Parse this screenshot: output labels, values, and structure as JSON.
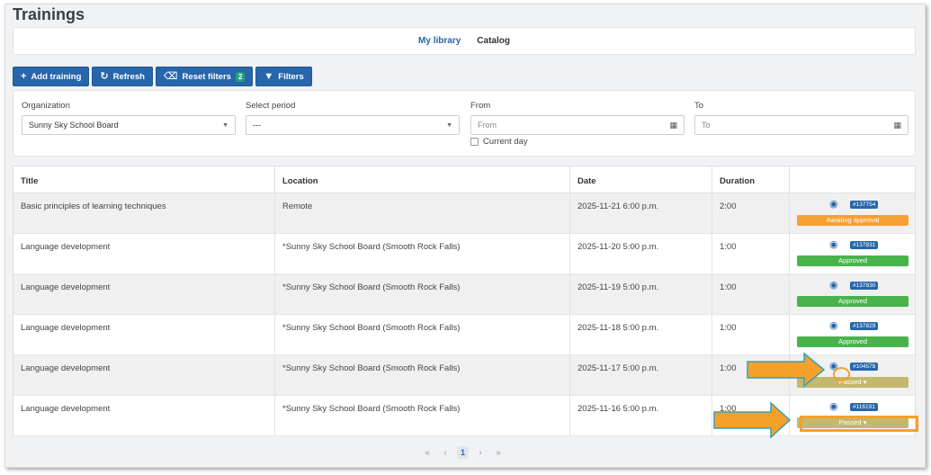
{
  "page": {
    "title": "Trainings"
  },
  "tabs": [
    "My library",
    "Catalog"
  ],
  "toolbar": {
    "add_label": "Add training",
    "refresh_label": "Refresh",
    "reset_label": "Reset filters",
    "reset_count": "2",
    "filters_label": "Filters"
  },
  "filters": {
    "organization_label": "Organization",
    "organization_value": "Sunny Sky School Board",
    "period_label": "Select period",
    "period_value": "---",
    "from_label": "From",
    "from_placeholder": "From",
    "current_day_label": "Current day",
    "to_label": "To",
    "to_placeholder": "To"
  },
  "table": {
    "columns": [
      "Title",
      "Location",
      "Date",
      "Duration",
      ""
    ],
    "rows": [
      {
        "title": "Basic principles of learning techniques",
        "location": "Remote",
        "date": "2025-11-21 6:00 p.m.",
        "duration": "2:00",
        "id": "#137754",
        "status": "Awaiting approval",
        "status_type": "await"
      },
      {
        "title": "Language development",
        "location": "*Sunny Sky School Board (Smooth Rock Falls)",
        "date": "2025-11-20 5:00 p.m.",
        "duration": "1:00",
        "id": "#137831",
        "status": "Approved",
        "status_type": "appr"
      },
      {
        "title": "Language development",
        "location": "*Sunny Sky School Board (Smooth Rock Falls)",
        "date": "2025-11-19 5:00 p.m.",
        "duration": "1:00",
        "id": "#137830",
        "status": "Approved",
        "status_type": "appr"
      },
      {
        "title": "Language development",
        "location": "*Sunny Sky School Board (Smooth Rock Falls)",
        "date": "2025-11-18 5:00 p.m.",
        "duration": "1:00",
        "id": "#137829",
        "status": "Approved",
        "status_type": "appr"
      },
      {
        "title": "Language development",
        "location": "*Sunny Sky School Board (Smooth Rock Falls)",
        "date": "2025-11-17 5:00 p.m.",
        "duration": "1:00",
        "id": "#104578",
        "status": "Passed ▾",
        "status_type": "pass"
      },
      {
        "title": "Language development",
        "location": "*Sunny Sky School Board (Smooth Rock Falls)",
        "date": "2025-11-16 5:00 p.m.",
        "duration": "1:00",
        "id": "#116191",
        "status": "Passed ▾",
        "status_type": "pass"
      }
    ]
  },
  "pagination": {
    "current": "1",
    "first": "«",
    "prev": "‹",
    "next": "›",
    "last": "»"
  },
  "colors": {
    "primary": "#2766ab",
    "approved": "#49b34b",
    "awaiting": "#f5a033",
    "passed": "#c3b86d",
    "highlight": "#f3a12a"
  }
}
